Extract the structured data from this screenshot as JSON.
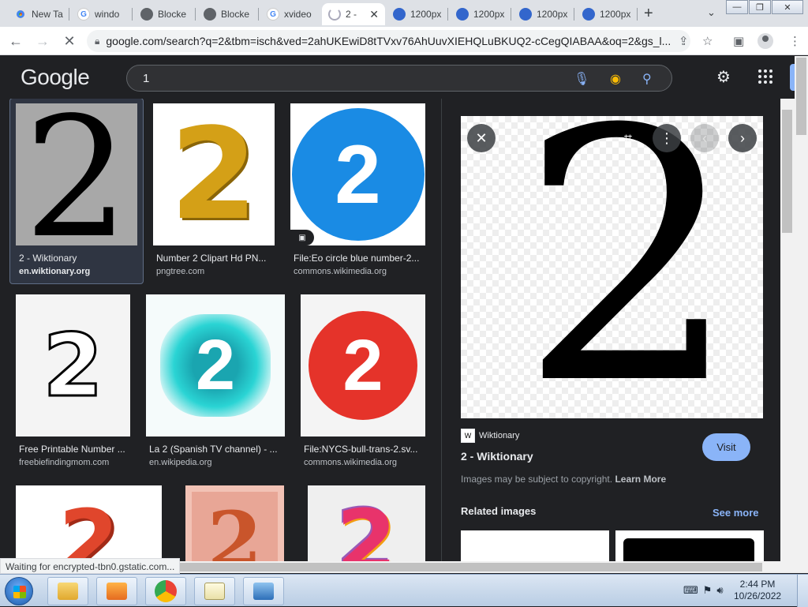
{
  "browser": {
    "tabs": [
      {
        "label": "New Ta",
        "icon": "chrome"
      },
      {
        "label": "windo",
        "icon": "google"
      },
      {
        "label": "Blocke",
        "icon": "globe"
      },
      {
        "label": "Blocke",
        "icon": "globe"
      },
      {
        "label": "xvideo",
        "icon": "google"
      },
      {
        "label": "2 -",
        "icon": "loading"
      },
      {
        "label": "1200px",
        "icon": "wiki"
      },
      {
        "label": "1200px",
        "icon": "wiki"
      },
      {
        "label": "1200px",
        "icon": "wiki"
      },
      {
        "label": "1200px",
        "icon": "wiki"
      }
    ],
    "url": "google.com/search?q=2&tbm=isch&ved=2ahUKEwiD8tTVxv76AhUuvXIEHQLuBKUQ2-cCegQIABAA&oq=2&gs_l..."
  },
  "google": {
    "logo": "Google",
    "query": "1"
  },
  "results": [
    {
      "title": "2 - Wiktionary",
      "source": "en.wiktionary.org",
      "glyph": "2"
    },
    {
      "title": "Number 2 Clipart Hd PN...",
      "source": "pngtree.com",
      "glyph": "2"
    },
    {
      "title": "File:Eo circle blue number-2...",
      "source": "commons.wikimedia.org",
      "glyph": "2"
    },
    {
      "title": "Free Printable Number ...",
      "source": "freebiefindingmom.com",
      "glyph": "2"
    },
    {
      "title": "La 2 (Spanish TV channel) - ...",
      "source": "en.wikipedia.org",
      "glyph": "2"
    },
    {
      "title": "File:NYCS-bull-trans-2.sv...",
      "source": "commons.wikimedia.org",
      "glyph": "2"
    },
    {
      "glyph": "2"
    },
    {
      "glyph": "2"
    },
    {
      "glyph": "2"
    }
  ],
  "preview": {
    "glyph": "2",
    "site_icon": "W",
    "site": "Wiktionary",
    "title": "2 - Wiktionary",
    "visit": "Visit",
    "copyright": "Images may be subject to copyright.",
    "learn_more": "Learn More",
    "related": "Related images",
    "see_more": "See more"
  },
  "status_text": "Waiting for encrypted-tbn0.gstatic.com...",
  "taskbar": {
    "time": "2:44 PM",
    "date": "10/26/2022"
  },
  "colors": {
    "page_bg": "#202124",
    "accent": "#8ab4f8",
    "circle_blue": "#1a8be4",
    "circle_red": "#e5332a",
    "gold": "#d4a017"
  }
}
